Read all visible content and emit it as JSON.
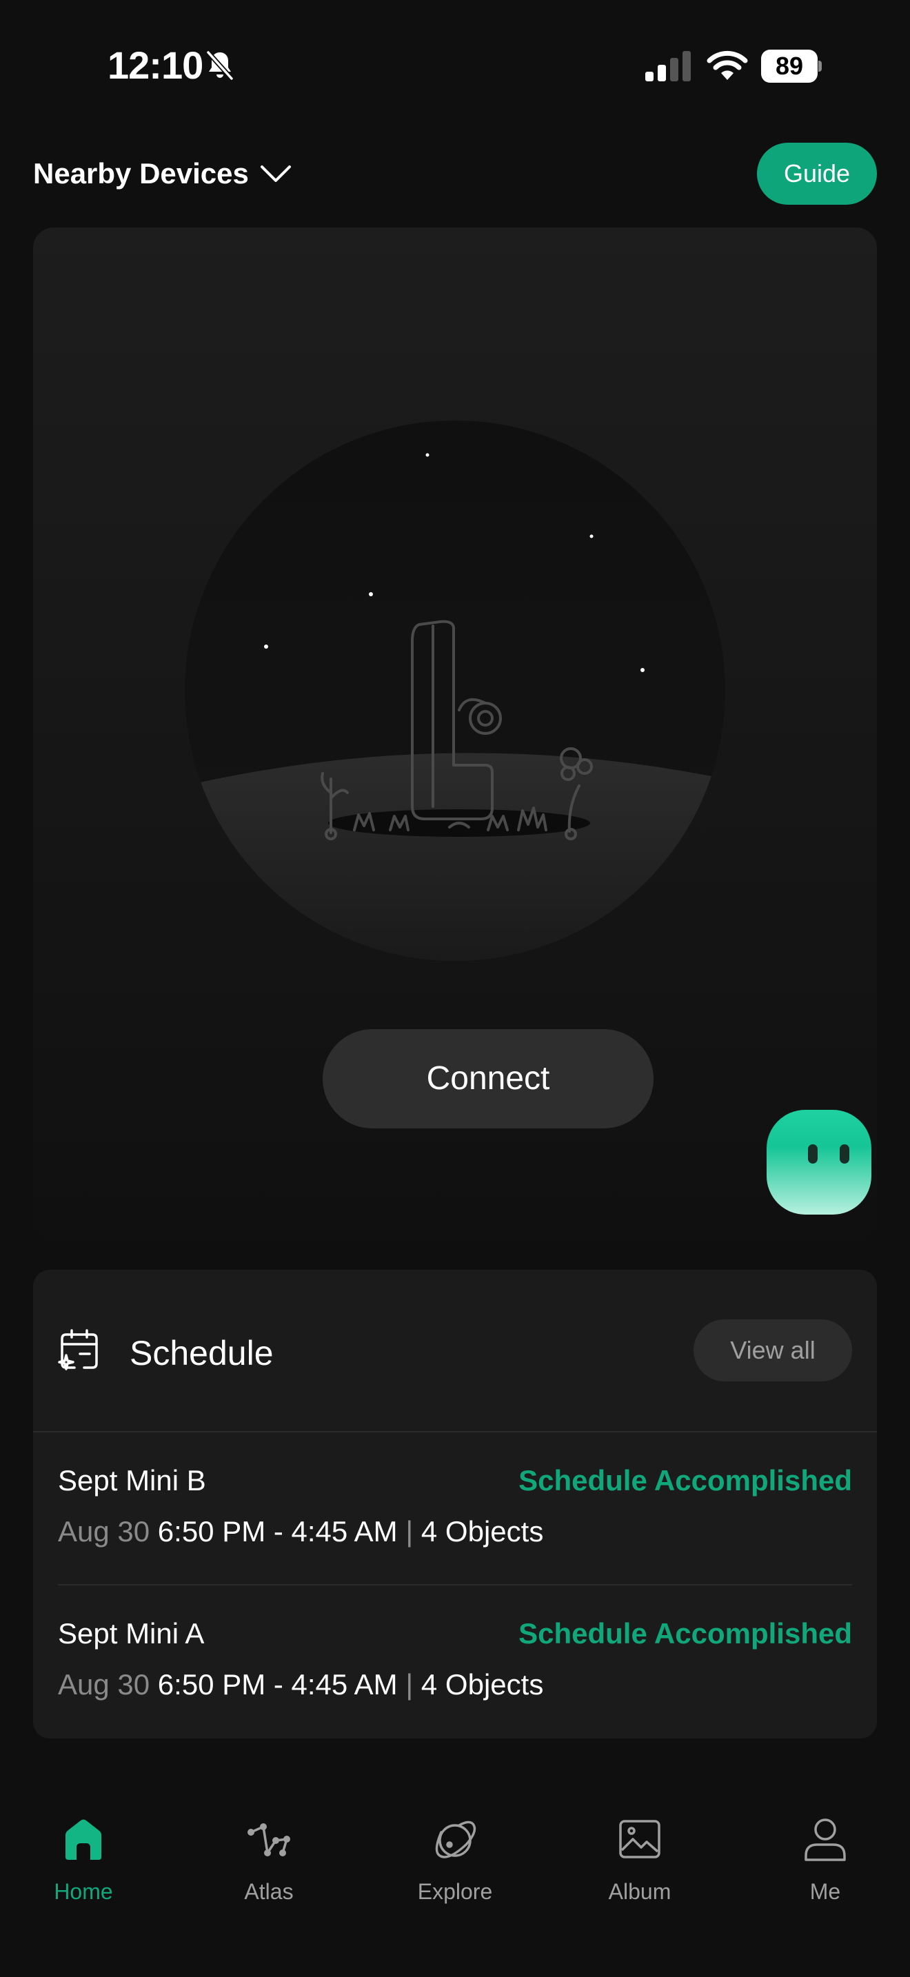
{
  "status_bar": {
    "time": "12:10",
    "battery": "89"
  },
  "header": {
    "devices_label": "Nearby Devices",
    "guide_label": "Guide"
  },
  "hero": {
    "connect_label": "Connect"
  },
  "schedule": {
    "title": "Schedule",
    "view_all_label": "View all",
    "items": [
      {
        "name": "Sept Mini B",
        "status": "Schedule Accomplished",
        "date": "Aug 30",
        "time": "6:50 PM - 4:45 AM",
        "separator": "|",
        "objects": "4 Objects"
      },
      {
        "name": "Sept Mini A",
        "status": "Schedule Accomplished",
        "date": "Aug 30",
        "time": "6:50 PM - 4:45 AM",
        "separator": "|",
        "objects": "4 Objects"
      }
    ]
  },
  "nav": {
    "items": [
      {
        "label": "Home",
        "icon": "home-icon",
        "active": true
      },
      {
        "label": "Atlas",
        "icon": "constellation-icon",
        "active": false
      },
      {
        "label": "Explore",
        "icon": "planet-icon",
        "active": false
      },
      {
        "label": "Album",
        "icon": "image-icon",
        "active": false
      },
      {
        "label": "Me",
        "icon": "person-icon",
        "active": false
      }
    ]
  },
  "colors": {
    "accent": "#10a77b",
    "background": "#0f0f0f",
    "card": "#1b1b1b"
  }
}
